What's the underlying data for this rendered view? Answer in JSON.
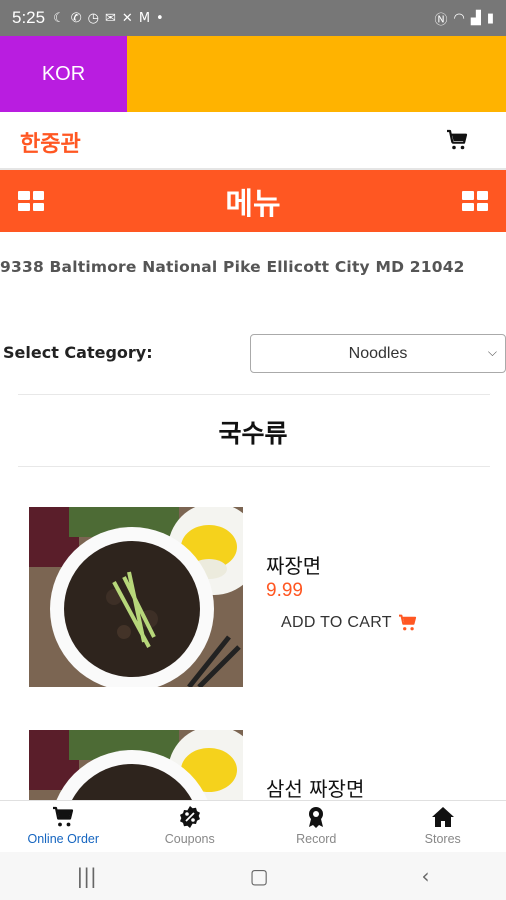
{
  "status_bar": {
    "time": "5:25",
    "icons_left": [
      "moon-icon",
      "wifi-call-icon",
      "timer-icon",
      "mail-icon",
      "tools-icon",
      "gmail-icon",
      "dot-icon"
    ],
    "icons_right": [
      "nfc-icon",
      "wifi-icon",
      "signal-icon",
      "battery-icon"
    ]
  },
  "lang": {
    "label": "KOR",
    "accent": "#b91de0",
    "bar_color": "#ffb300"
  },
  "store": {
    "name": "한중관",
    "brand_color": "#ff5722"
  },
  "menu_bar": {
    "title": "메뉴"
  },
  "address": "9338 Baltimore National Pike Ellicott City MD 21042",
  "category": {
    "label": "Select Category:",
    "selected": "Noodles"
  },
  "section_title": "국수류",
  "items": [
    {
      "name": "짜장면",
      "price": "9.99",
      "add_label": "ADD TO CART"
    },
    {
      "name": "삼선 짜장면"
    }
  ],
  "bottom_nav": [
    {
      "label": "Online Order",
      "icon": "cart-icon",
      "active": true
    },
    {
      "label": "Coupons",
      "icon": "percent-badge-icon",
      "active": false
    },
    {
      "label": "Record",
      "icon": "award-icon",
      "active": false
    },
    {
      "label": "Stores",
      "icon": "home-icon",
      "active": false
    }
  ]
}
